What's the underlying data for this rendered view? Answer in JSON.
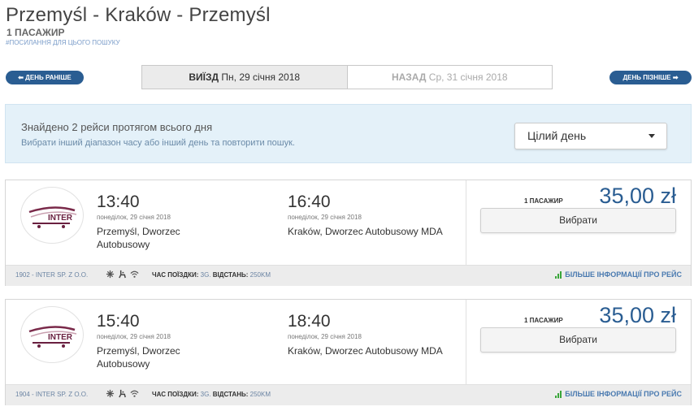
{
  "header": {
    "title": "Przemyśl - Kraków - Przemyśl",
    "passengers": "1 ПАСАЖИР",
    "permalink": "#ПОСИЛАННЯ ДЛЯ ЦЬОГО ПОШУКУ"
  },
  "nav": {
    "prev_label": "⬅ ДЕНЬ РАНІШЕ",
    "next_label": "ДЕНЬ ПІЗНІШЕ ➡",
    "outbound_prefix": "ВИЇЗД",
    "outbound_date": "Пн, 29 січня 2018",
    "return_prefix": "НАЗАД",
    "return_date": "Ср, 31 січня 2018"
  },
  "info": {
    "main": "Знайдено 2 рейси протягом всього дня",
    "sub": "Вибрати інший діапазон часу або інший день та повторити пошук.",
    "select_value": "Цілий день"
  },
  "trips": [
    {
      "logo_text": "INTER",
      "dep_time": "13:40",
      "dep_date": "понеділок, 29 січня 2018",
      "dep_place": "Przemyśl, Dworzec Autobusowy",
      "arr_time": "16:40",
      "arr_date": "понеділок, 29 січня 2018",
      "arr_place": "Kraków, Dworzec Autobusowy MDA",
      "price_passengers": "1 ПАСАЖИР",
      "price": "35,00 zł",
      "select_label": "Вибрати",
      "carrier": "1902 - INTER SP. Z O.O.",
      "duration_label": "ЧАС ПОЇЗДКИ:",
      "duration": "3G.",
      "distance_label": "ВІДСТАНЬ:",
      "distance": "250KM",
      "more_label": "БІЛЬШЕ ІНФОРМАЦІЇ ПРО РЕЙС"
    },
    {
      "logo_text": "INTER",
      "dep_time": "15:40",
      "dep_date": "понеділок, 29 січня 2018",
      "dep_place": "Przemyśl, Dworzec Autobusowy",
      "arr_time": "18:40",
      "arr_date": "понеділок, 29 січня 2018",
      "arr_place": "Kraków, Dworzec Autobusowy MDA",
      "price_passengers": "1 ПАСАЖИР",
      "price": "35,00 zł",
      "select_label": "Вибрати",
      "carrier": "1904 - INTER SP. Z O.O.",
      "duration_label": "ЧАС ПОЇЗДКИ:",
      "duration": "3G.",
      "distance_label": "ВІДСТАНЬ:",
      "distance": "250KM",
      "more_label": "БІЛЬШЕ ІНФОРМАЦІЇ ПРО РЕЙС"
    }
  ],
  "colors": {
    "accent": "#2a5d92",
    "info_bg": "#e4f1f9",
    "footer_bg": "#ececec",
    "signal_green": "#3aa63a"
  },
  "icons": {
    "amenities": [
      "air-conditioning-icon",
      "accessible-seat-icon",
      "wifi-icon"
    ],
    "more_info": "signal-bars-icon"
  }
}
